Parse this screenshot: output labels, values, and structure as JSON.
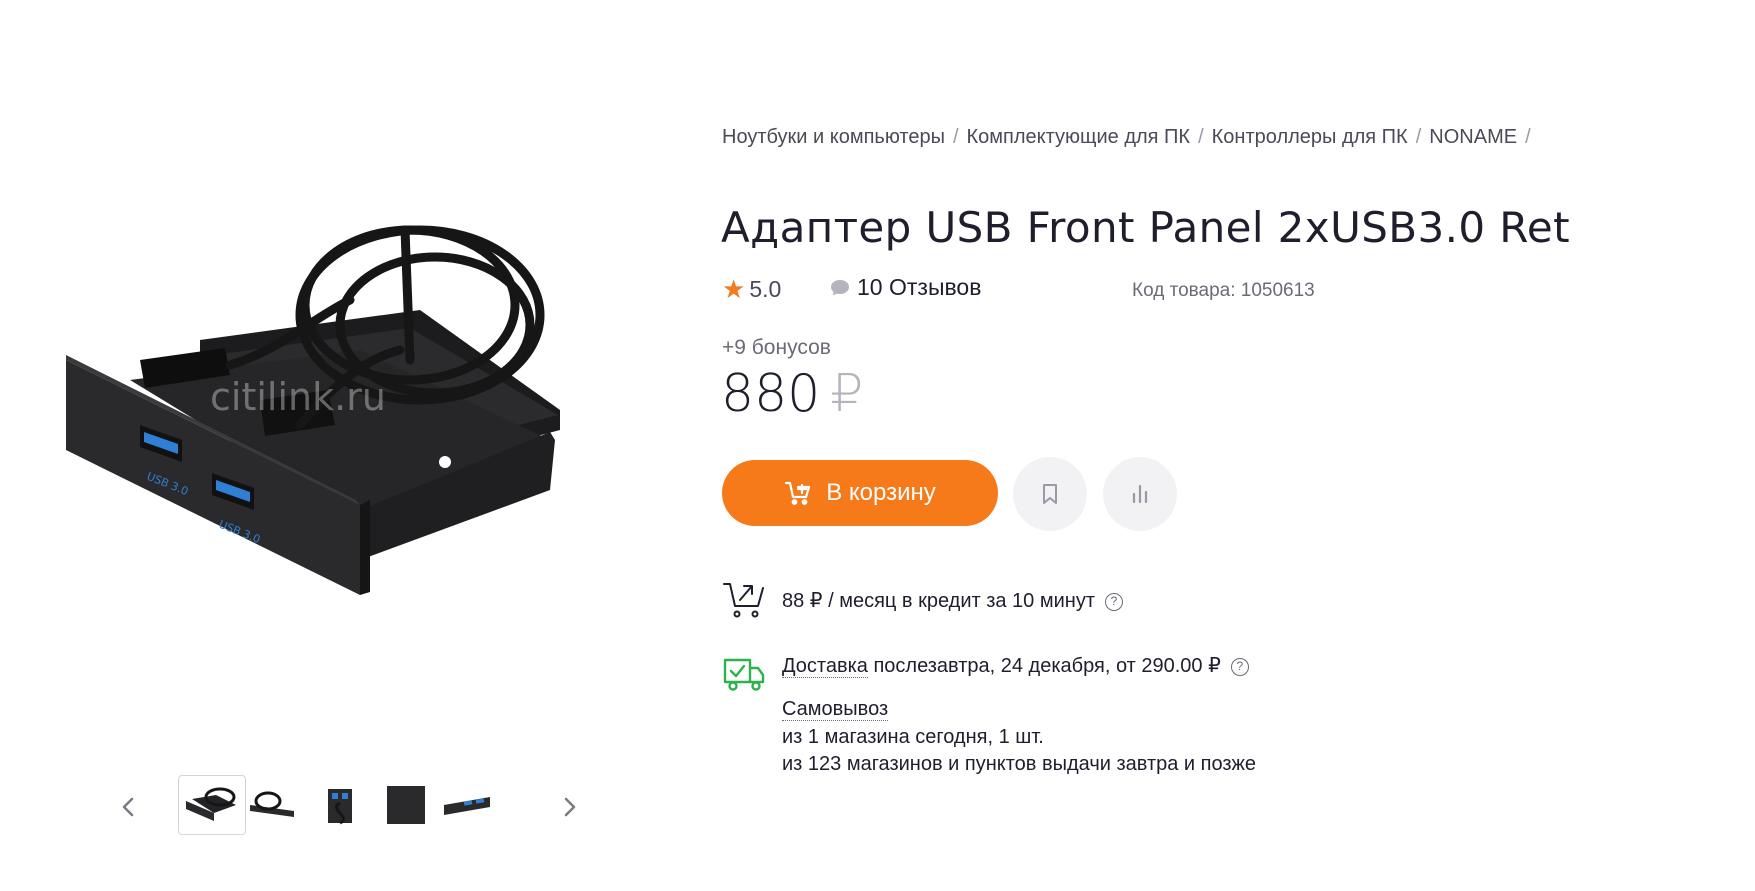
{
  "breadcrumb": {
    "items": [
      "Ноутбуки и компьютеры",
      "Комплектующие для ПК",
      "Контроллеры для ПК",
      "NONAME"
    ],
    "separator": "/"
  },
  "product": {
    "title": "Адаптер USB Front Panel 2xUSB3.0 Ret",
    "rating": "5.0",
    "reviews": "10 Отзывов",
    "code": "Код товара: 1050613",
    "bonus": "+9 бонусов",
    "price": "880",
    "currency": "₽"
  },
  "gallery": {
    "watermark": "citilink.ru",
    "port_label": "USB 3.0",
    "thumbnails": 5,
    "active_thumbnail": 1
  },
  "actions": {
    "cart_label": "В корзину",
    "accent_color": "#f6791a"
  },
  "credit": {
    "text": "88 ₽ / месяц в кредит за 10 минут"
  },
  "delivery": {
    "label": "Доставка",
    "text": " послезавтра, 24 декабря, от 290.00 ₽",
    "pickup_title": "Самовывоз",
    "pickup_line1": "из 1 магазина сегодня, 1 шт.",
    "pickup_line2": "из 123 магазинов и пунктов выдачи завтра и позже",
    "icon_color": "#2db34a"
  },
  "icons": [
    "star-icon",
    "comment-icon",
    "cart-add-icon",
    "bookmark-icon",
    "compare-icon",
    "credit-cart-icon",
    "help-icon",
    "delivery-truck-icon",
    "chevron-left-icon",
    "chevron-right-icon"
  ]
}
